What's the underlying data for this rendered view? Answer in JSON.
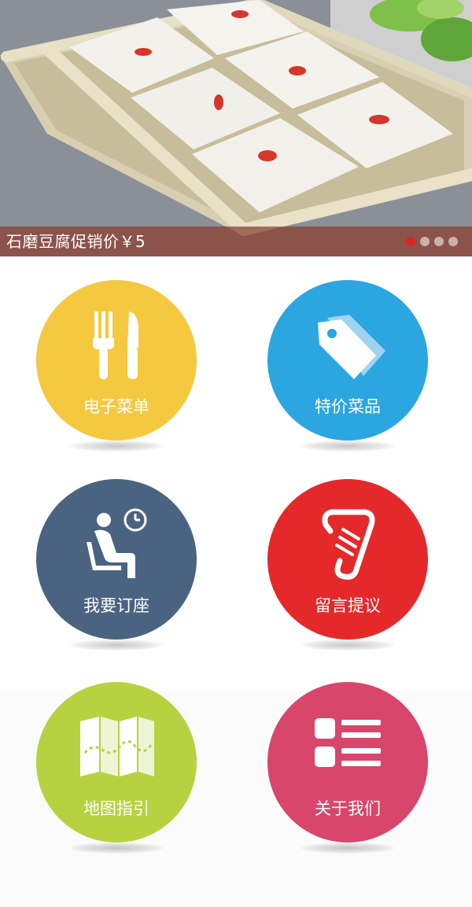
{
  "banner": {
    "caption": "石磨豆腐促销价￥5",
    "dots": 4,
    "active_dot": 1
  },
  "colors": {
    "yellow": "#f5c93f",
    "blue": "#2ba6e1",
    "slate": "#4a6380",
    "red": "#e5292b",
    "green": "#b7d240",
    "pink": "#d9466b"
  },
  "menu": {
    "items": [
      {
        "label": "电子菜单",
        "icon": "fork-knife-icon"
      },
      {
        "label": "特价菜品",
        "icon": "price-tag-icon"
      },
      {
        "label": "我要订座",
        "icon": "seat-reservation-icon"
      },
      {
        "label": "留言提议",
        "icon": "scroll-message-icon"
      },
      {
        "label": "地图指引",
        "icon": "map-icon"
      },
      {
        "label": "关于我们",
        "icon": "list-icon"
      }
    ]
  }
}
